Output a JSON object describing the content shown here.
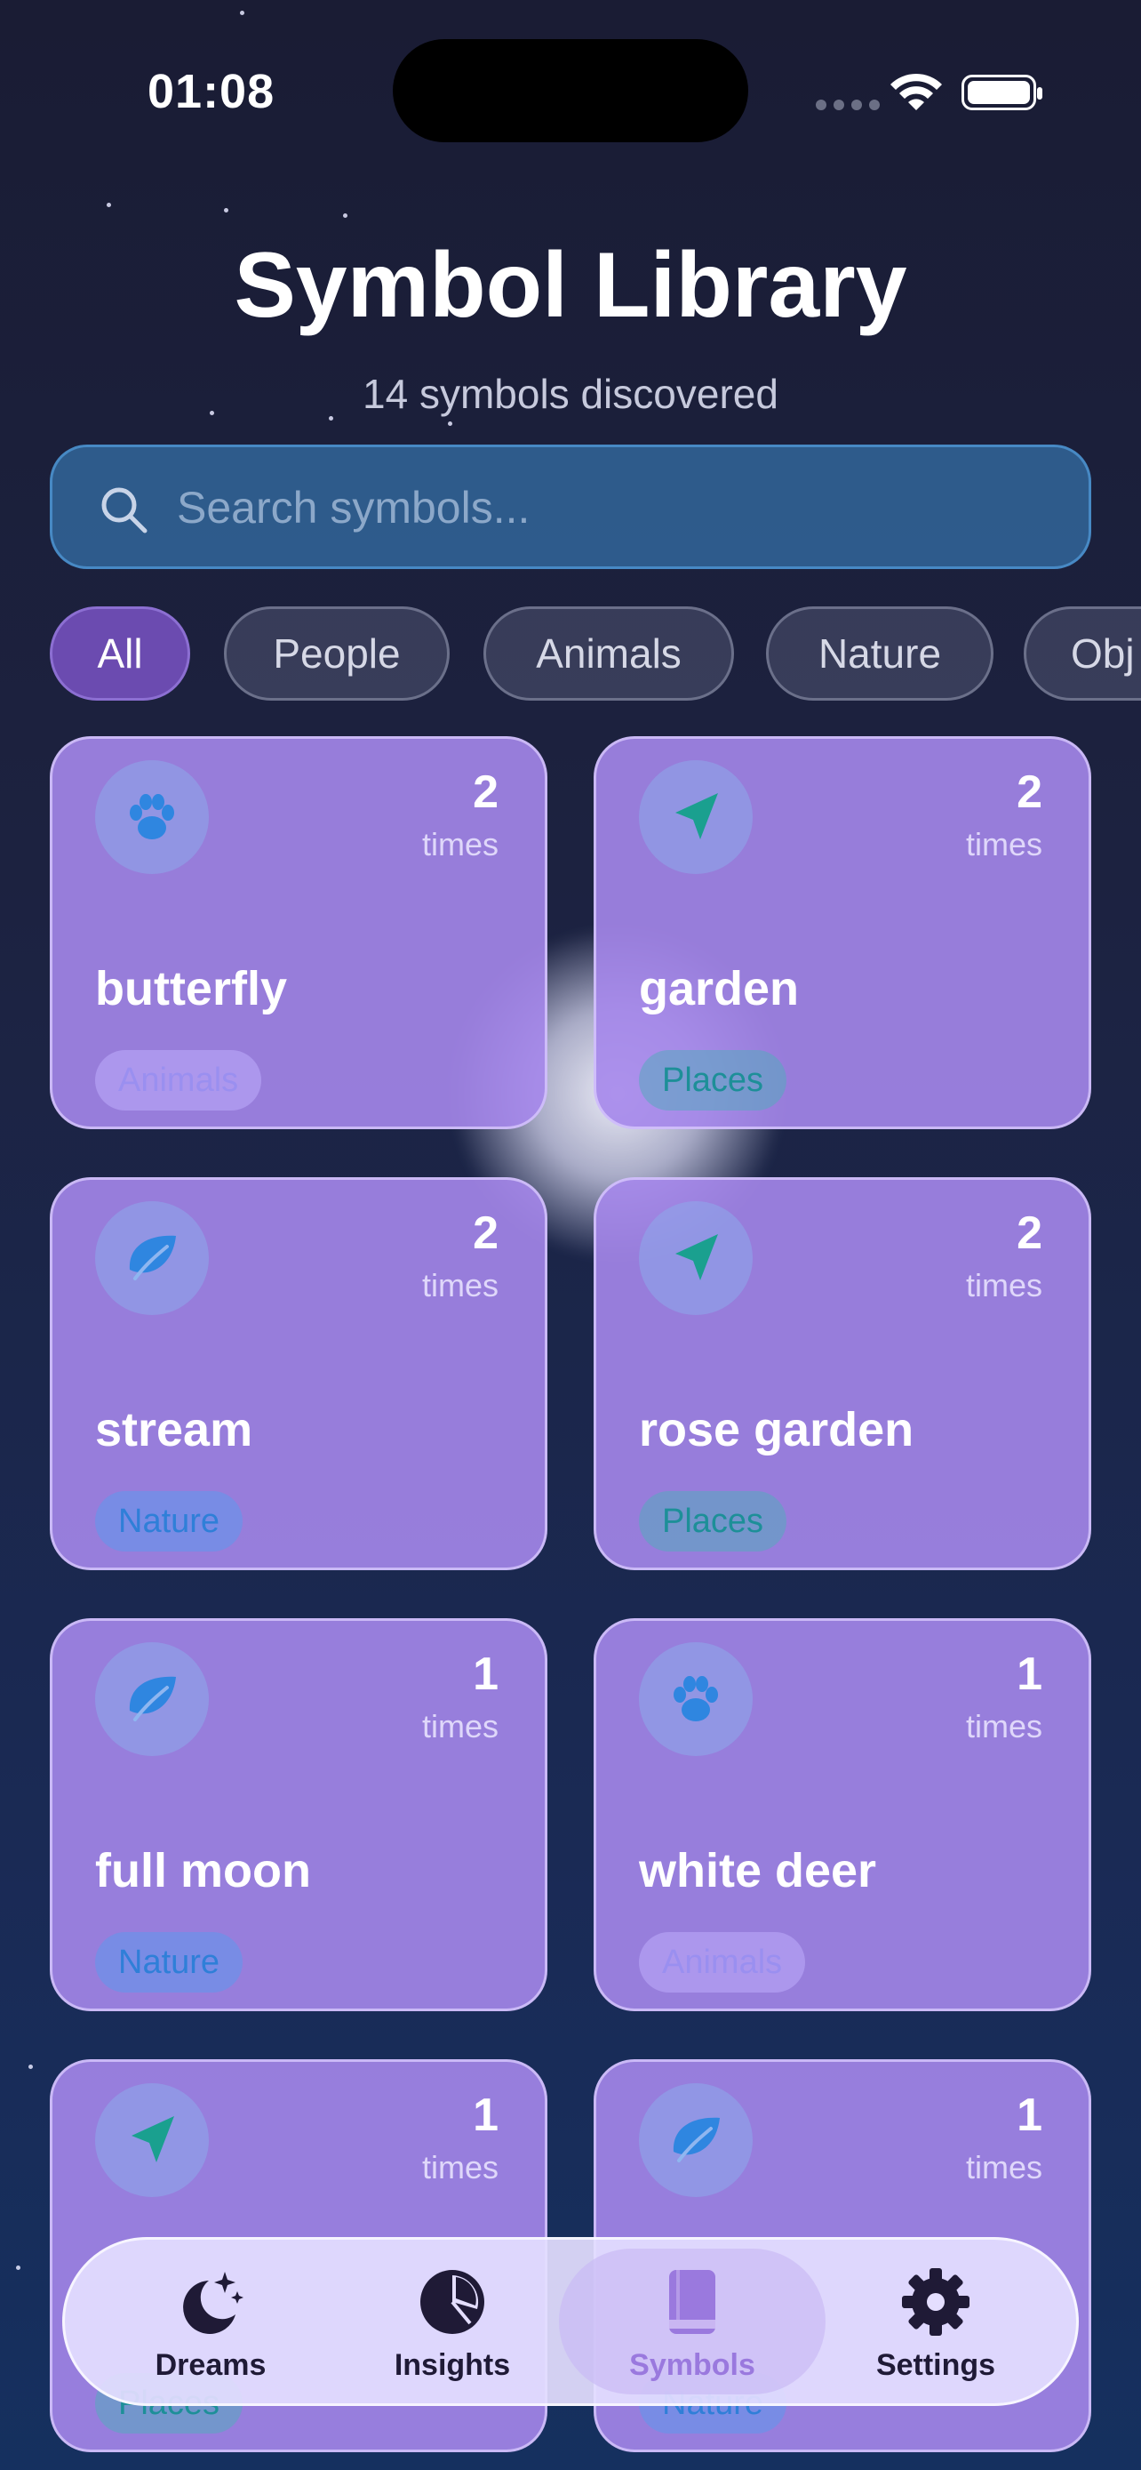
{
  "status_bar": {
    "time": "01:08"
  },
  "header": {
    "title": "Symbol Library",
    "subtitle": "14 symbols discovered"
  },
  "search": {
    "placeholder": "Search symbols..."
  },
  "filters": [
    {
      "label": "All",
      "active": true
    },
    {
      "label": "People",
      "active": false
    },
    {
      "label": "Animals",
      "active": false
    },
    {
      "label": "Nature",
      "active": false
    },
    {
      "label": "Obj",
      "active": false
    }
  ],
  "symbols": [
    {
      "name": "butterfly",
      "count": "2",
      "times_label": "times",
      "category": "Animals",
      "icon": "paw-icon"
    },
    {
      "name": "garden",
      "count": "2",
      "times_label": "times",
      "category": "Places",
      "icon": "location-arrow-icon"
    },
    {
      "name": "stream",
      "count": "2",
      "times_label": "times",
      "category": "Nature",
      "icon": "leaf-icon"
    },
    {
      "name": "rose garden",
      "count": "2",
      "times_label": "times",
      "category": "Places",
      "icon": "location-arrow-icon"
    },
    {
      "name": "full moon",
      "count": "1",
      "times_label": "times",
      "category": "Nature",
      "icon": "leaf-icon"
    },
    {
      "name": "white deer",
      "count": "1",
      "times_label": "times",
      "category": "Animals",
      "icon": "paw-icon"
    },
    {
      "name": "",
      "count": "1",
      "times_label": "times",
      "category": "Places",
      "icon": "location-arrow-icon"
    },
    {
      "name": "",
      "count": "1",
      "times_label": "times",
      "category": "Nature",
      "icon": "leaf-icon"
    }
  ],
  "tabbar": {
    "tabs": [
      {
        "label": "Dreams",
        "icon": "moon-stars-icon"
      },
      {
        "label": "Insights",
        "icon": "pie-chart-icon"
      },
      {
        "label": "Symbols",
        "icon": "book-icon",
        "selected": true
      },
      {
        "label": "Settings",
        "icon": "gear-icon"
      }
    ]
  },
  "colors": {
    "background": "#1c2240",
    "card": "#a587eb",
    "chip_active": "#6b4bb0",
    "tab_selected": "#9a79de"
  }
}
